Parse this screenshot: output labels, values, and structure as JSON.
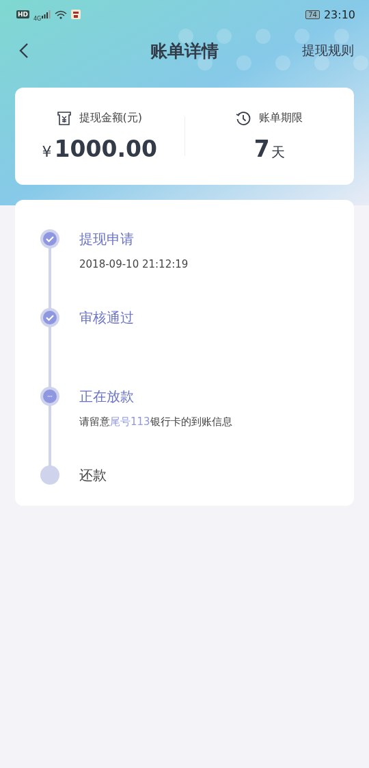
{
  "status_bar": {
    "badge": "HD",
    "network": "4G",
    "battery": "74",
    "time": "23:10"
  },
  "header": {
    "title": "账单详情",
    "action": "提现规则"
  },
  "summary": [
    {
      "kind": "amount",
      "label": "提现金额(元)",
      "currency": "¥",
      "value": "1000.00"
    },
    {
      "kind": "term",
      "label": "账单期限",
      "value": "7",
      "unit": "天"
    }
  ],
  "steps": [
    {
      "title": "提现申请",
      "kind": "done",
      "detail": [
        {
          "text": "2018-09-10 21:12:19",
          "highlight": false
        }
      ]
    },
    {
      "title": "审核通过",
      "kind": "done"
    },
    {
      "title": "正在放款",
      "kind": "active",
      "detail": [
        {
          "text": "请留意",
          "highlight": false
        },
        {
          "text": "尾号113",
          "highlight": true
        },
        {
          "text": "银行卡的到账信息",
          "highlight": false
        }
      ]
    },
    {
      "title": "还款",
      "kind": "pending"
    }
  ]
}
